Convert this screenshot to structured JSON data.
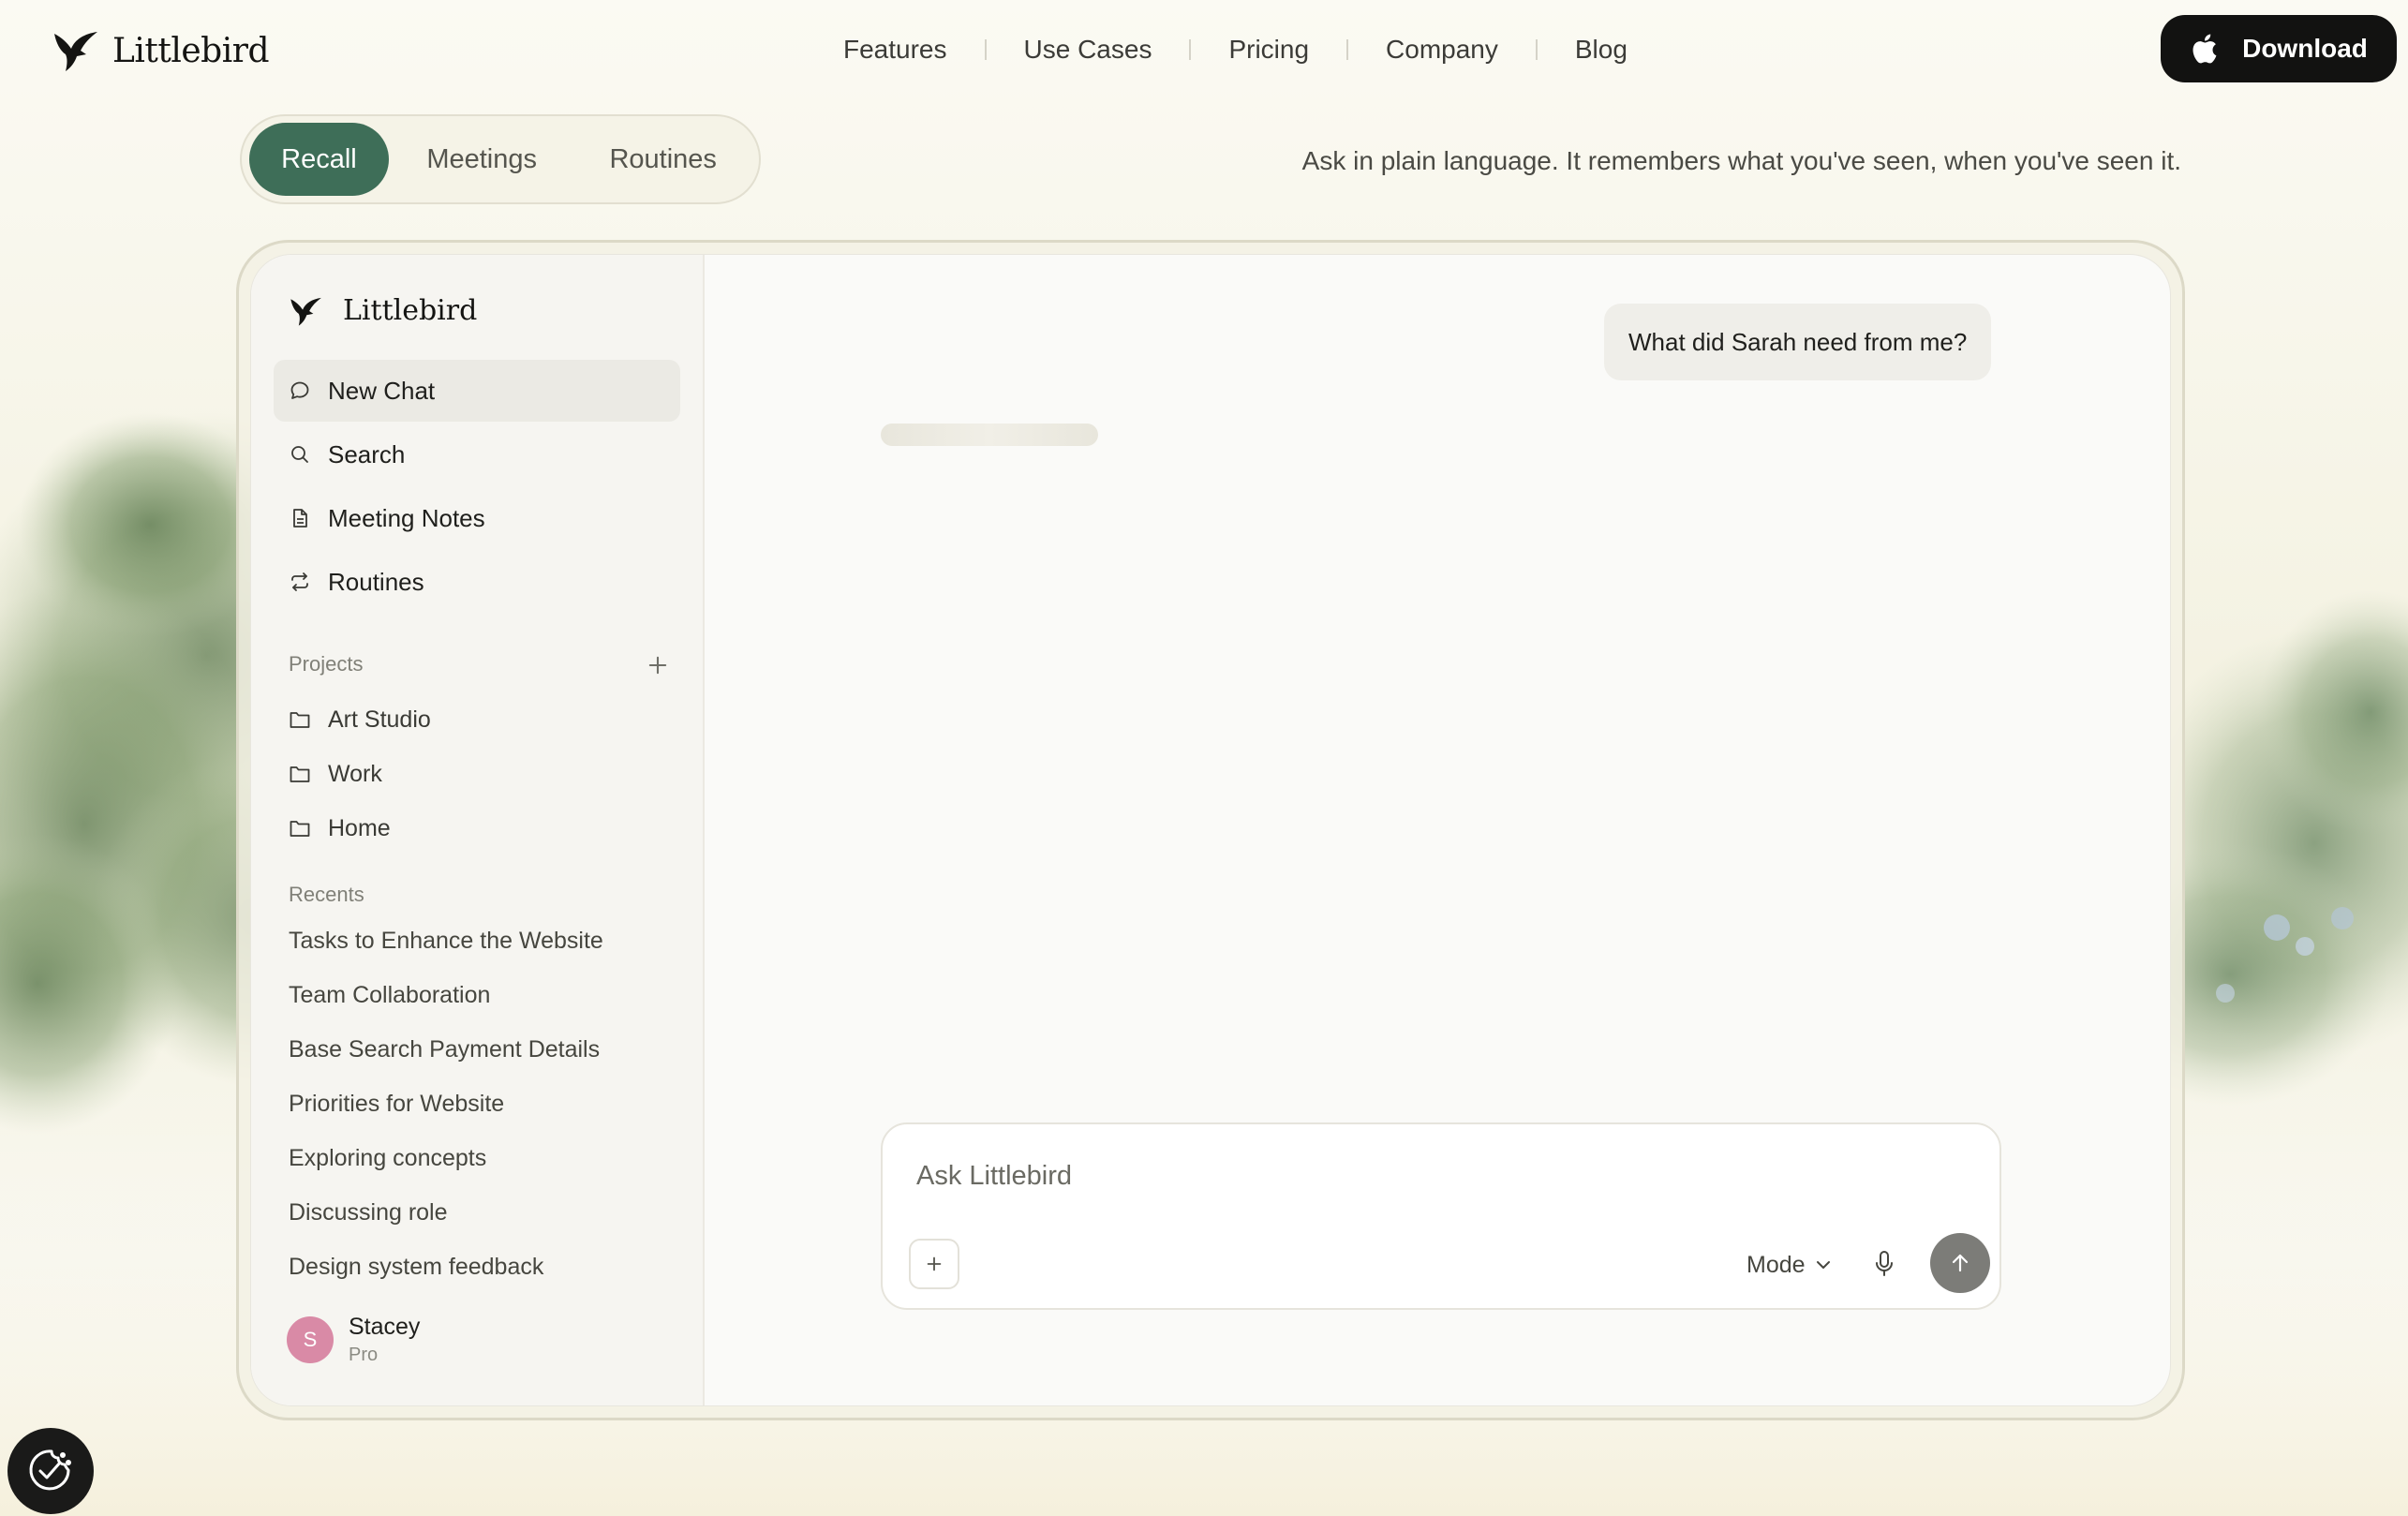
{
  "brand": {
    "name": "Littlebird"
  },
  "nav": {
    "links": [
      "Features",
      "Use Cases",
      "Pricing",
      "Company",
      "Blog"
    ],
    "download_label": "Download"
  },
  "segments": {
    "tabs": [
      "Recall",
      "Meetings",
      "Routines"
    ],
    "active": "Recall"
  },
  "tagline": "Ask in plain language. It remembers what you've seen, when you've seen it.",
  "sidebar": {
    "brand": "Littlebird",
    "menu": [
      {
        "label": "New Chat",
        "icon": "chat-bubble-icon"
      },
      {
        "label": "Search",
        "icon": "search-icon"
      },
      {
        "label": "Meeting Notes",
        "icon": "document-icon"
      },
      {
        "label": "Routines",
        "icon": "repeat-icon"
      }
    ],
    "projects_label": "Projects",
    "projects": [
      "Art Studio",
      "Work",
      "Home"
    ],
    "recents_label": "Recents",
    "recents": [
      "Tasks to Enhance the Website",
      "Team Collaboration",
      "Base Search Payment Details",
      "Priorities for Website",
      "Exploring concepts",
      "Discussing role",
      "Design system feedback"
    ],
    "user": {
      "initial": "S",
      "name": "Stacey",
      "plan": "Pro"
    }
  },
  "chat": {
    "user_message": "What did Sarah need from me?",
    "input_placeholder": "Ask Littlebird",
    "mode_label": "Mode"
  },
  "colors": {
    "accent": "#3e6e58",
    "download_bg": "#121211",
    "send_bg": "#7c7c78",
    "avatar": "#d98aa6"
  }
}
